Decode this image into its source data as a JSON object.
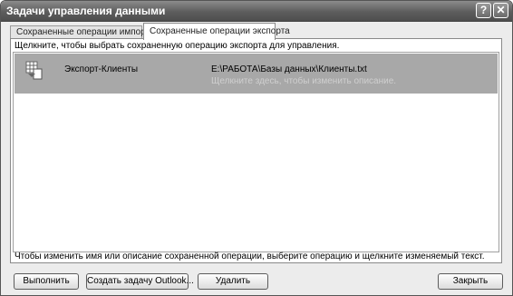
{
  "window": {
    "title": "Задачи управления данными",
    "help_label": "?",
    "close_label": "✕"
  },
  "tabs": [
    {
      "label": "Сохраненные операции импорта",
      "selected": false
    },
    {
      "label": "Сохраненные операции экспорта",
      "selected": true
    }
  ],
  "panel": {
    "hint_top": "Щелкните, чтобы выбрать сохраненную операцию экспорта для управления.",
    "hint_bottom": "Чтобы изменить имя или описание сохраненной операции, выберите операцию и щелкните изменяемый текст."
  },
  "items": [
    {
      "icon": "table-export-icon",
      "name": "Экспорт-Клиенты",
      "path": "E:\\РАБОТА\\Базы данных\\Клиенты.txt",
      "description": "Щелкните здесь, чтобы изменить описание."
    }
  ],
  "buttons": {
    "run": "Выполнить",
    "outlook": "Создать задачу Outlook...",
    "delete": "Удалить",
    "close": "Закрыть"
  }
}
